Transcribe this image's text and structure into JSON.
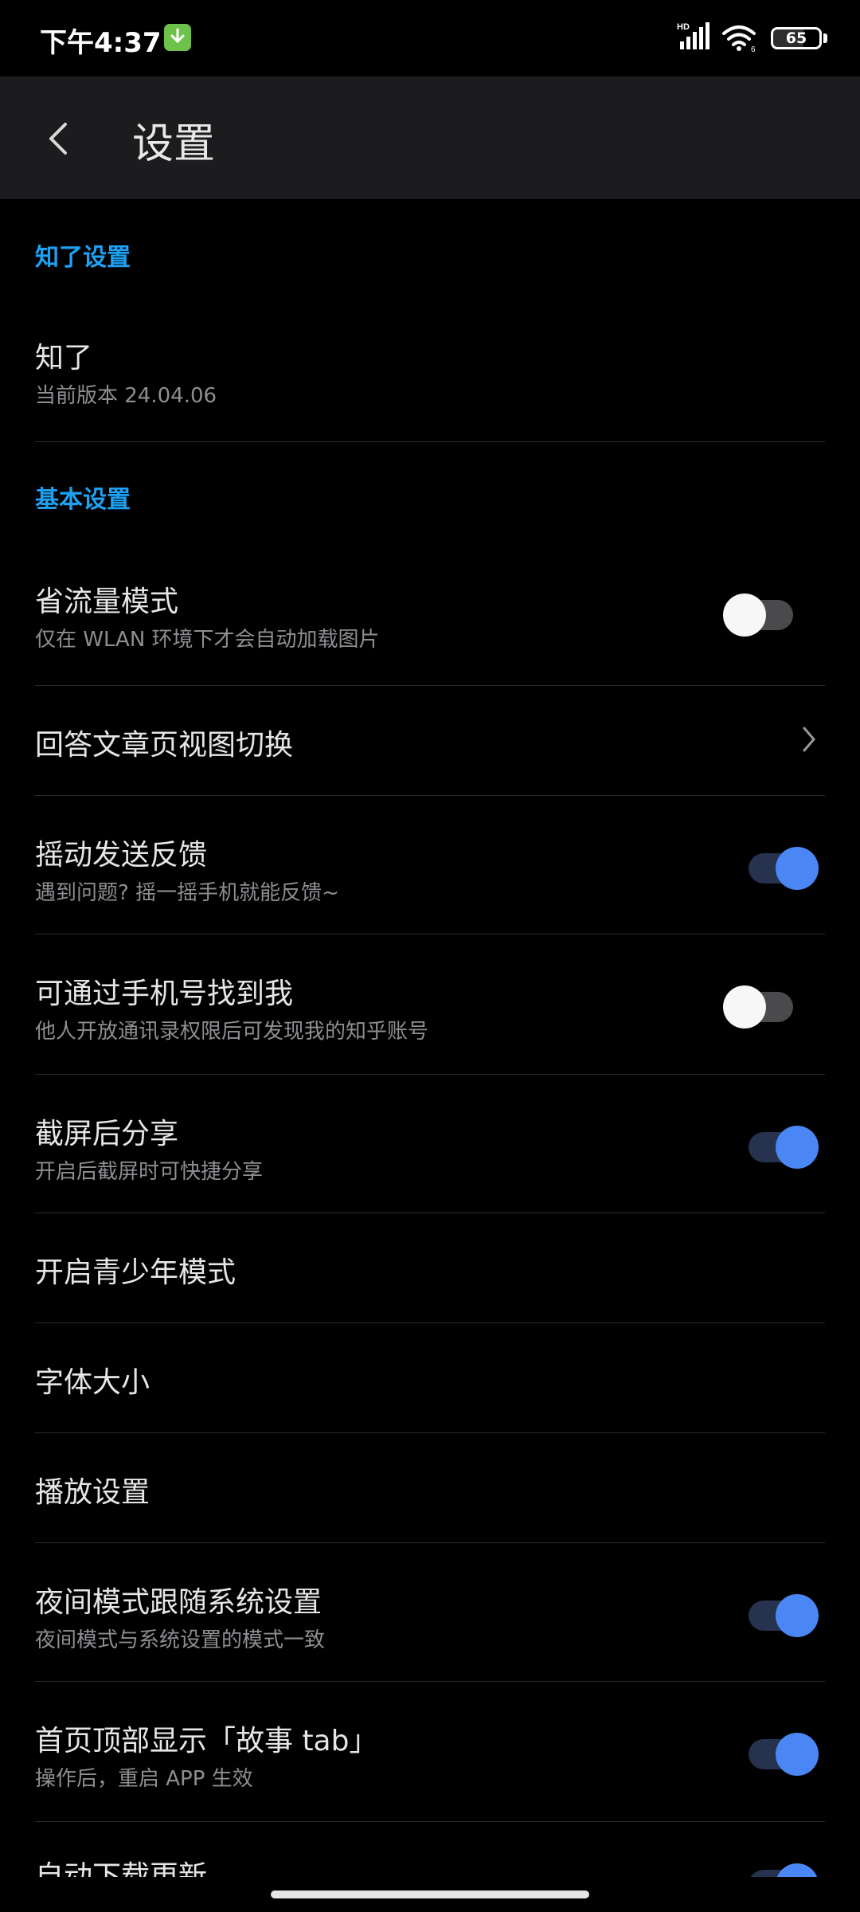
{
  "status_bar": {
    "time": "下午4:37",
    "battery": "65",
    "wifi_badge": "6",
    "network_label": "HD"
  },
  "app_bar": {
    "title": "设置"
  },
  "sections": {
    "zhiliao": {
      "header": "知了设置"
    },
    "basic": {
      "header": "基本设置"
    }
  },
  "items": [
    {
      "title": "知了",
      "subtitle": "当前版本 24.04.06"
    },
    {
      "title": "省流量模式",
      "subtitle": "仅在 WLAN 环境下才会自动加载图片",
      "toggle": "off"
    },
    {
      "title": "回答文章页视图切换",
      "control": "chevron-right-icon"
    },
    {
      "title": "摇动发送反馈",
      "subtitle": "遇到问题? 摇一摇手机就能反馈~",
      "toggle": "on"
    },
    {
      "title": "可通过手机号找到我",
      "subtitle": "他人开放通讯录权限后可发现我的知乎账号",
      "toggle": "off"
    },
    {
      "title": "截屏后分享",
      "subtitle": "开启后截屏时可快捷分享",
      "toggle": "on"
    },
    {
      "title": "开启青少年模式"
    },
    {
      "title": "字体大小"
    },
    {
      "title": "播放设置"
    },
    {
      "title": "夜间模式跟随系统设置",
      "subtitle": "夜间模式与系统设置的模式一致",
      "toggle": "on"
    },
    {
      "title": "首页顶部显示「故事 tab」",
      "subtitle": "操作后，重启 APP 生效",
      "toggle": "on"
    },
    {
      "title": "自动下载更新",
      "toggle": "on"
    }
  ],
  "colors": {
    "accent": "#1ea1f2",
    "toggle_on": "#4a87f5",
    "background": "#000000",
    "app_bar": "#1c1c1e"
  }
}
